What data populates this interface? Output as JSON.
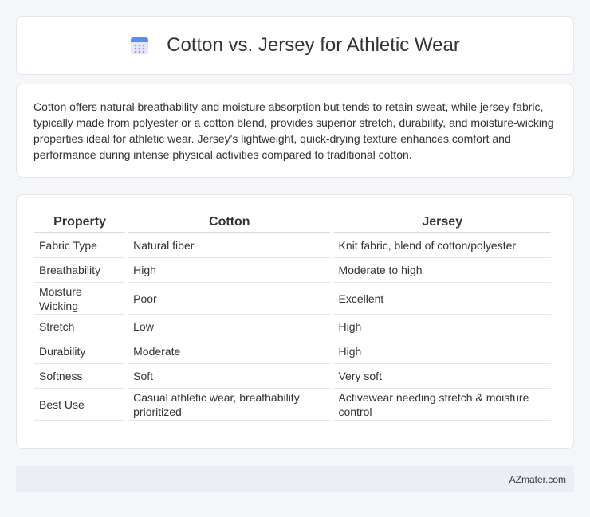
{
  "header": {
    "icon": "calendar-icon",
    "title": "Cotton vs. Jersey for Athletic Wear"
  },
  "description": "Cotton offers natural breathability and moisture absorption but tends to retain sweat, while jersey fabric, typically made from polyester or a cotton blend, provides superior stretch, durability, and moisture-wicking properties ideal for athletic wear. Jersey's lightweight, quick-drying texture enhances comfort and performance during intense physical activities compared to traditional cotton.",
  "table": {
    "headers": [
      "Property",
      "Cotton",
      "Jersey"
    ],
    "rows": [
      [
        "Fabric Type",
        "Natural fiber",
        "Knit fabric, blend of cotton/polyester"
      ],
      [
        "Breathability",
        "High",
        "Moderate to high"
      ],
      [
        "Moisture Wicking",
        "Poor",
        "Excellent"
      ],
      [
        "Stretch",
        "Low",
        "High"
      ],
      [
        "Durability",
        "Moderate",
        "High"
      ],
      [
        "Softness",
        "Soft",
        "Very soft"
      ],
      [
        "Best Use",
        "Casual athletic wear, breathability prioritized",
        "Activewear needing stretch & moisture control"
      ]
    ]
  },
  "footer": {
    "brand": "AZmater.com"
  }
}
